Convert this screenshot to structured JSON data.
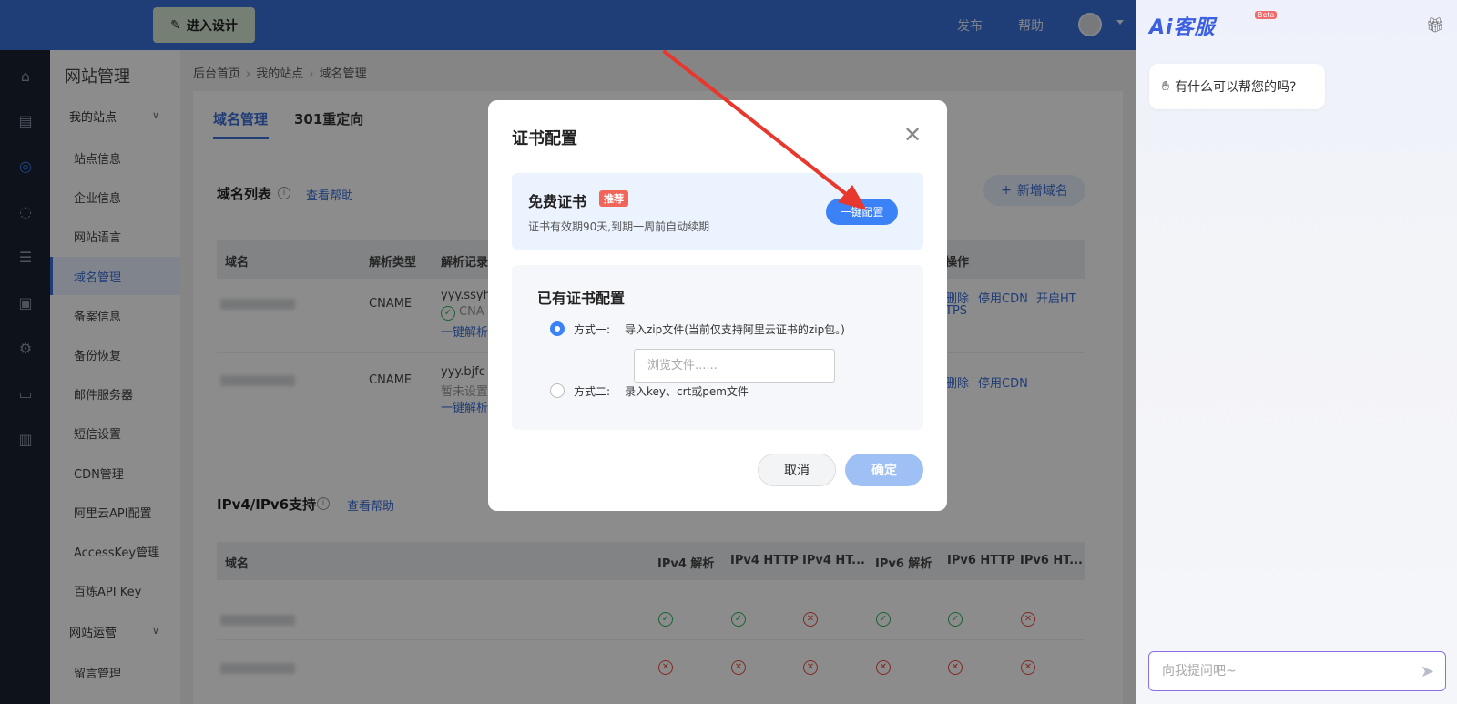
{
  "topbar": {
    "design_label": "进入设计",
    "publish": "发布",
    "help": "帮助"
  },
  "sidebar": {
    "title": "网站管理",
    "group1": "我的站点",
    "items": [
      "站点信息",
      "企业信息",
      "网站语言",
      "域名管理",
      "备案信息",
      "备份恢复",
      "邮件服务器",
      "短信设置",
      "CDN管理",
      "阿里云API配置",
      "AccessKey管理",
      "百炼API Key"
    ],
    "group2": "网站运营",
    "item_after": "留言管理"
  },
  "breadcrumb": [
    "后台首页",
    "我的站点",
    "域名管理"
  ],
  "tabs": [
    "域名管理",
    "301重定向"
  ],
  "domain_card": {
    "title": "域名列表",
    "help": "查看帮助",
    "add_btn": "新增域名",
    "headers": [
      "域名",
      "解析类型",
      "解析记录",
      "操作"
    ],
    "rows": [
      {
        "type": "CNAME",
        "record": "yyy.ssyh",
        "status": "CNA",
        "fix": "一键解析",
        "ops": [
          "删除",
          "停用CDN",
          "开启HT"
        ],
        "ops_wrap": "TPS"
      },
      {
        "type": "CNAME",
        "record": "yyy.bjfc",
        "status": "暂未设置",
        "fix": "一键解析",
        "ops": [
          "删除",
          "停用CDN"
        ]
      }
    ]
  },
  "ip_card": {
    "title": "IPv4/IPv6支持",
    "help": "查看帮助",
    "headers": [
      "域名",
      "IPv4 解析",
      "IPv4 HTTP",
      "IPv4 HT...",
      "IPv6 解析",
      "IPv6 HTTP",
      "IPv6 HT..."
    ],
    "rows": [
      [
        "ok",
        "ok",
        "no",
        "ok",
        "ok",
        "no"
      ],
      [
        "no",
        "no",
        "no",
        "no",
        "no",
        "no"
      ]
    ]
  },
  "ai": {
    "logo": "Ai客服",
    "beta": "Beta",
    "greeting": "有什么可以帮您的吗?",
    "input_placeholder": "向我提问吧~"
  },
  "modal": {
    "title": "证书配置",
    "free_title": "免费证书",
    "free_tag": "推荐",
    "free_desc": "证书有效期90天,到期一周前自动续期",
    "one_click": "一键配置",
    "exist_title": "已有证书配置",
    "opt1_prefix": "方式一:",
    "opt1_text": "导入zip文件(当前仅支持阿里云证书的zip包。)",
    "file_placeholder": "浏览文件......",
    "opt2_prefix": "方式二:",
    "opt2_text": "录入key、crt或pem文件",
    "cancel": "取消",
    "confirm": "确定"
  }
}
